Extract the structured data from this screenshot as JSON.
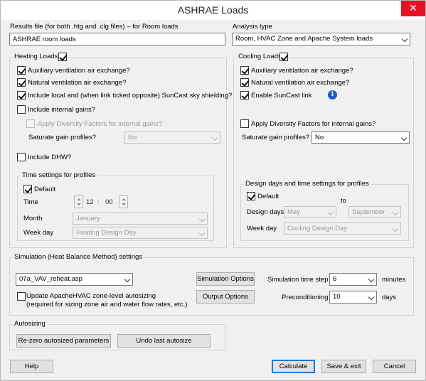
{
  "window": {
    "title": "ASHRAE Loads",
    "close_glyph": "✕"
  },
  "results_file": {
    "label": "Results file  (for both .htg and .clg files) – for Room loads",
    "value": "ASHRAE room loads"
  },
  "analysis": {
    "label": "Analysis type",
    "value": "Room, HVAC Zone and Apache System loads"
  },
  "heating": {
    "title": "Heating Loads",
    "checked": true,
    "aux_vent": "Auxiliary ventilation air exchange?",
    "nat_vent": "Natural ventilation air exchange?",
    "suncast": "Include local and (when link ticked opposite) SunCast sky shielding?",
    "internal_gains": "Include internal gains?",
    "diversity": "Apply Diversity Factors for internal gains?",
    "saturate_label": "Saturate gain profiles?",
    "saturate_value": "No",
    "dhw": "Include DHW?",
    "time_group": "Time settings for profiles",
    "default_label": "Default",
    "time_label": "Time",
    "hour": "12",
    "minute": "00",
    "month_label": "Month",
    "month_value": "January",
    "weekday_label": "Week day",
    "weekday_value": "Heating Design Day"
  },
  "cooling": {
    "title": "Cooling Loads",
    "checked": true,
    "aux_vent": "Auxiliary ventilation air exchange?",
    "nat_vent": "Natural ventilation air exchange?",
    "suncast": "Enable SunCast link",
    "info_glyph": "i",
    "diversity": "Apply Diversity Factors for internal gains?",
    "saturate_label": "Saturate gain profiles?",
    "saturate_value": "No",
    "design_group": "Design days and time settings for profiles",
    "default_label": "Default",
    "to_label": "to",
    "design_days_label": "Design days",
    "from_month": "May",
    "to_month": "September",
    "weekday_label": "Week day",
    "weekday_value": "Cooling Design Day"
  },
  "simulation": {
    "title": "Simulation (Heat Balance Method) settings",
    "system_file": "07a_VAV_reheat.asp",
    "options_btn": "Simulation Options",
    "output_btn": "Output Options",
    "timestep_label": "Simulation time step",
    "timestep_value": "6",
    "timestep_unit": "minutes",
    "precond_label": "Preconditioning",
    "precond_value": "10",
    "precond_unit": "days",
    "update_line1": "Update ApacheHVAC zone-level autosizing",
    "update_line2": "(required for sizing zone air and water flow rates, etc.)"
  },
  "autosizing": {
    "title": "Autosizing",
    "rezero_btn": "Re-zero autosized parameters",
    "undo_btn": "Undo last autosize"
  },
  "footer": {
    "help": "Help",
    "calculate": "Calculate",
    "save_exit": "Save & exit",
    "cancel": "Cancel"
  }
}
